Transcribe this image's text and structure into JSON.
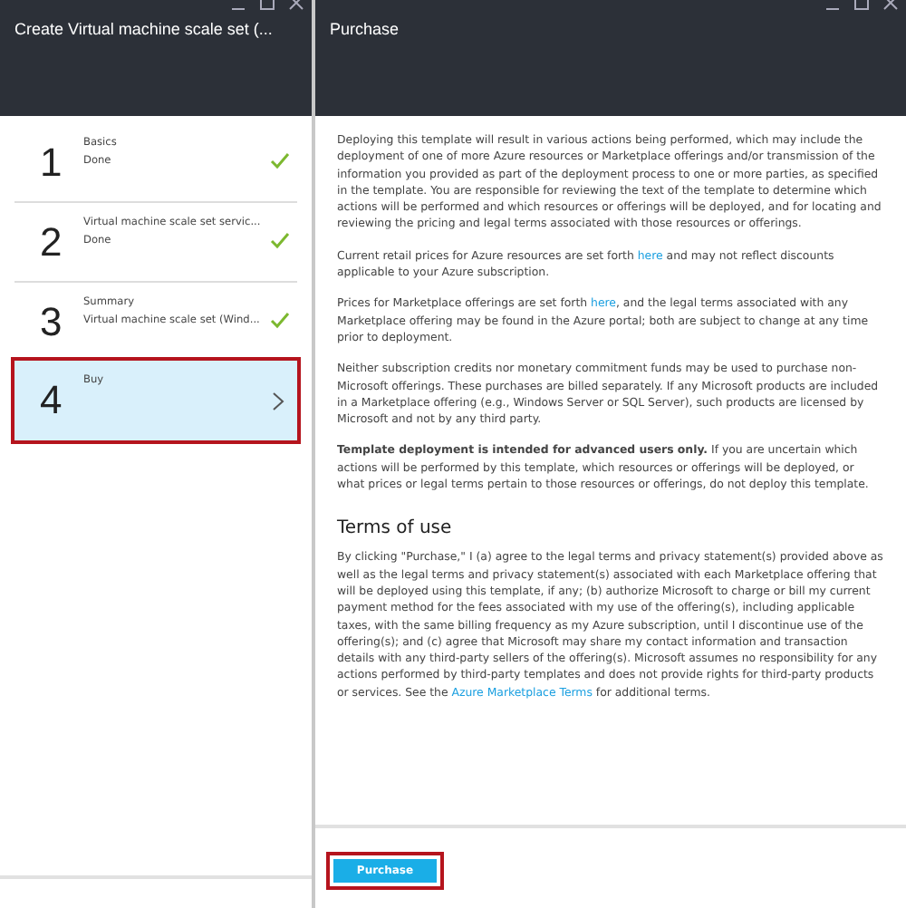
{
  "left_blade": {
    "title": "Create Virtual machine scale set (...",
    "steps": [
      {
        "number": "1",
        "title": "Basics",
        "subtitle": "Done",
        "done": true,
        "selected": false,
        "highlighted": false
      },
      {
        "number": "2",
        "title": "Virtual machine scale set servic...",
        "subtitle": "Done",
        "done": true,
        "selected": false,
        "highlighted": false
      },
      {
        "number": "3",
        "title": "Summary",
        "subtitle": "Virtual machine scale set (Wind...",
        "done": true,
        "selected": false,
        "highlighted": false
      },
      {
        "number": "4",
        "title": "Buy",
        "done": false,
        "selected": true,
        "highlighted": true
      }
    ]
  },
  "right_blade": {
    "title": "Purchase",
    "paragraphs": [
      [
        {
          "kind": "plain",
          "text": "Deploying this template will result in various actions being performed, which may include the deployment of one of more Azure resources or Marketplace offerings and/or transmission of the information you provided as part of the deployment process to one or more parties, as specified in the template. You are responsible for reviewing the text of the template to determine which actions will be performed and which resources or offerings will be deployed, and for locating and reviewing the pricing and legal terms associated with those resources or offerings."
        }
      ],
      [
        {
          "kind": "plain",
          "text": "Current retail prices for Azure resources are set forth "
        },
        {
          "kind": "link",
          "text": "here"
        },
        {
          "kind": "plain",
          "text": " and may not reflect discounts applicable to your Azure subscription."
        }
      ],
      [
        {
          "kind": "plain",
          "text": "Prices for Marketplace offerings are set forth "
        },
        {
          "kind": "link",
          "text": "here"
        },
        {
          "kind": "plain",
          "text": ", and the legal terms associated with any Marketplace offering may be found in the Azure portal; both are subject to change at any time prior to deployment."
        }
      ],
      [
        {
          "kind": "plain",
          "text": "Neither subscription credits nor monetary commitment funds may be used to purchase non-Microsoft offerings. These purchases are billed separately. If any Microsoft products are included in a Marketplace offering (e.g., Windows Server or SQL Server), such products are licensed by Microsoft and not by any third party."
        }
      ],
      [
        {
          "kind": "bold",
          "text": "Template deployment is intended for advanced users only."
        },
        {
          "kind": "plain",
          "text": " If you are uncertain which actions will be performed by this template, which resources or offerings will be deployed, or what prices or legal terms pertain to those resources or offerings, do not deploy this template."
        }
      ]
    ],
    "terms_heading": "Terms of use",
    "terms": [
      {
        "kind": "plain",
        "text": "By clicking \"Purchase,\" I (a) agree to the legal terms and privacy statement(s) provided above as well as the legal terms and privacy statement(s) associated with each Marketplace offering that will be deployed using this template, if any; (b) authorize Microsoft to charge or bill my current payment method for the fees associated with my use of the offering(s), including applicable taxes, with the same billing frequency as my Azure subscription, until I discontinue use of the offering(s); and (c) agree that Microsoft may share my contact information and transaction details with any third-party sellers of the offering(s). Microsoft assumes no responsibility for any actions performed by third-party templates and does not provide rights for third-party products or services. See the "
      },
      {
        "kind": "link",
        "text": "Azure Marketplace Terms"
      },
      {
        "kind": "plain",
        "text": " for additional terms."
      }
    ],
    "button": {
      "label": "Purchase",
      "highlighted": true
    }
  }
}
